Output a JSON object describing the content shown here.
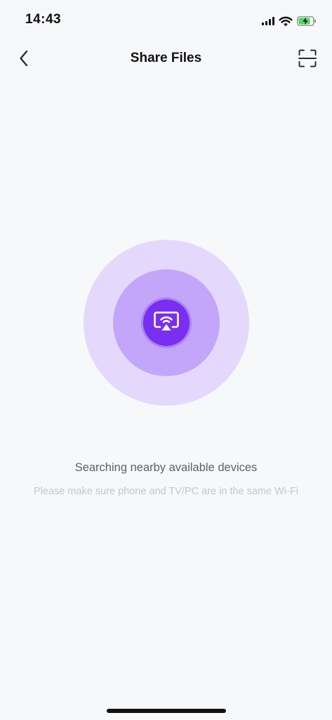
{
  "status_bar": {
    "time": "14:43",
    "icons": [
      "signal-icon",
      "wifi-icon",
      "battery-charging-icon"
    ],
    "battery_color": "#4cd964"
  },
  "nav": {
    "title": "Share Files",
    "back_icon": "chevron-left-icon",
    "scan_icon": "scan-icon"
  },
  "search": {
    "center_icon": "screen-cast-icon",
    "status": "Searching nearby available devices",
    "hint": "Please make sure phone and TV/PC are in the same Wi-Fi"
  },
  "colors": {
    "accent": "#7a2ef0",
    "ring_outer": "#e4d9fd",
    "ring_middle": "#c3a6fa",
    "background": "#f7f8fa"
  }
}
